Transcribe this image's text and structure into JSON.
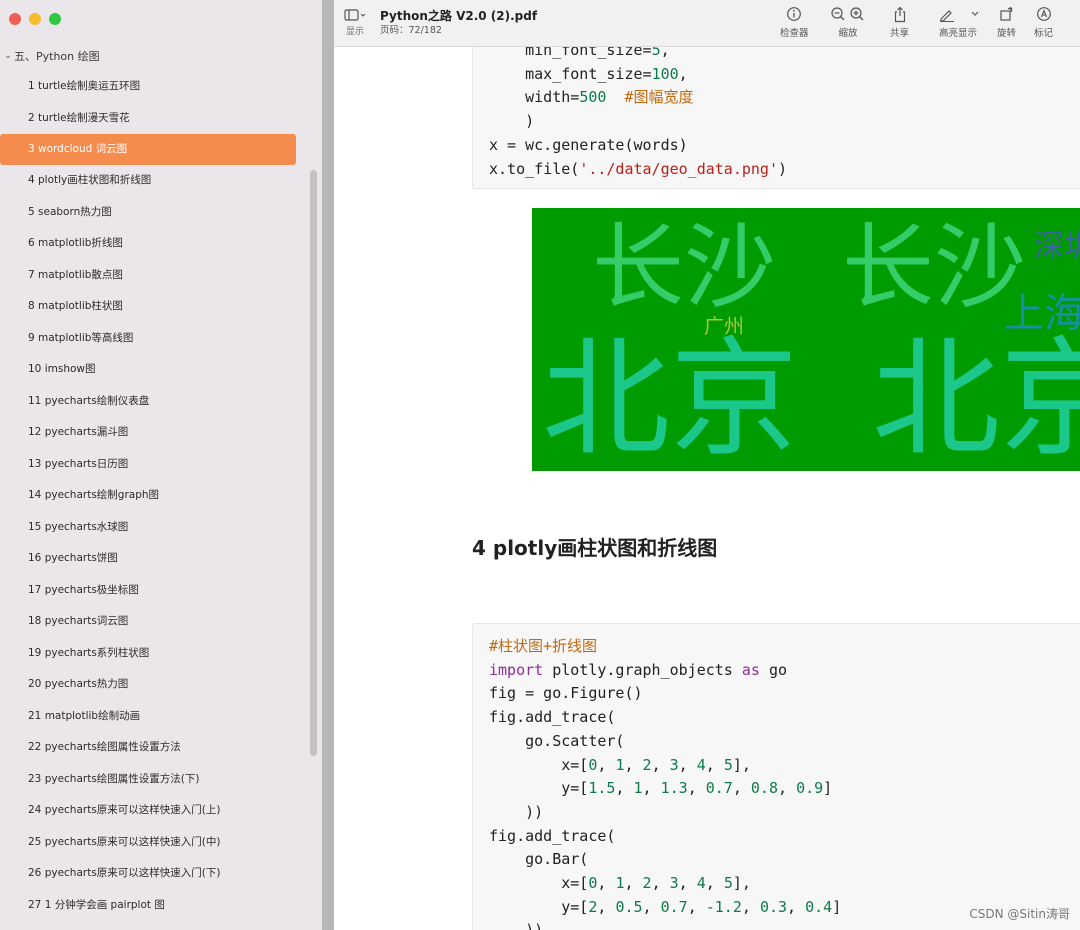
{
  "sidebar": {
    "section_label": "五、Python 绘图",
    "items": [
      {
        "label": "1 turtle绘制奥运五环图"
      },
      {
        "label": "2 turtle绘制漫天雪花"
      },
      {
        "label": "3 wordcloud 词云图"
      },
      {
        "label": "4 plotly画柱状图和折线图"
      },
      {
        "label": "5 seaborn热力图"
      },
      {
        "label": "6 matplotlib折线图"
      },
      {
        "label": "7 matplotlib散点图"
      },
      {
        "label": "8 matplotlib柱状图"
      },
      {
        "label": "9 matplotlib等高线图"
      },
      {
        "label": "10 imshow图"
      },
      {
        "label": "11 pyecharts绘制仪表盘"
      },
      {
        "label": "12 pyecharts漏斗图"
      },
      {
        "label": "13 pyecharts日历图"
      },
      {
        "label": "14 pyecharts绘制graph图"
      },
      {
        "label": "15 pyecharts水球图"
      },
      {
        "label": "16 pyecharts饼图"
      },
      {
        "label": "17 pyecharts极坐标图"
      },
      {
        "label": "18 pyecharts词云图"
      },
      {
        "label": "19 pyecharts系列柱状图"
      },
      {
        "label": "20 pyecharts热力图"
      },
      {
        "label": "21 matplotlib绘制动画"
      },
      {
        "label": "22 pyecharts绘图属性设置方法"
      },
      {
        "label": "23 pyecharts绘图属性设置方法(下)"
      },
      {
        "label": "24 pyecharts原来可以这样快速入门(上)"
      },
      {
        "label": "25 pyecharts原来可以这样快速入门(中)"
      },
      {
        "label": "26 pyecharts原来可以这样快速入门(下)"
      },
      {
        "label": "27 1 分钟学会画 pairplot 图"
      }
    ],
    "active_index": 2,
    "active_color": "#f68b4e"
  },
  "toolbar": {
    "view_label": "显示",
    "doc_title": "Python之路 V2.0 (2).pdf",
    "page_indicator": "页码：72/182",
    "buttons": [
      {
        "icon": "info-icon",
        "label": "检查器"
      },
      {
        "icon": "zoom-icon",
        "label": "缩放"
      },
      {
        "icon": "share-icon",
        "label": "共享"
      },
      {
        "icon": "highlight-icon",
        "label": "高亮显示"
      },
      {
        "icon": "rotate-icon",
        "label": "旋转"
      },
      {
        "icon": "markup-icon",
        "label": "标记"
      }
    ]
  },
  "document": {
    "code_block_1": [
      "    min_font_size=5,",
      "    max_font_size=100,",
      "    width=500  #图幅宽度",
      "    )",
      "x = wc.generate(words)",
      "x.to_file('../data/geo_data.png')"
    ],
    "wordcloud_words": [
      "长沙",
      "长沙",
      "深圳",
      "广州",
      "上海",
      "北京",
      "北京"
    ],
    "wordcloud_colors": {
      "background": "#009b00",
      "changsha": "#35cc6a",
      "beijing": "#1cc78a",
      "guangzhou": "#a6c83a",
      "shanghai": "#1a8fa0",
      "shenzhen": "#3a64a8"
    },
    "section_heading": "4 plotly画柱状图和折线图",
    "code_block_2": [
      "#柱状图+折线图",
      "import plotly.graph_objects as go",
      "fig = go.Figure()",
      "fig.add_trace(",
      "    go.Scatter(",
      "        x=[0, 1, 2, 3, 4, 5],",
      "        y=[1.5, 1, 1.3, 0.7, 0.8, 0.9]",
      "    ))",
      "fig.add_trace(",
      "    go.Bar(",
      "        x=[0, 1, 2, 3, 4, 5],",
      "        y=[2, 0.5, 0.7, -1.2, 0.3, 0.4]",
      "    ))"
    ]
  },
  "watermark": "CSDN @Sitin涛哥"
}
